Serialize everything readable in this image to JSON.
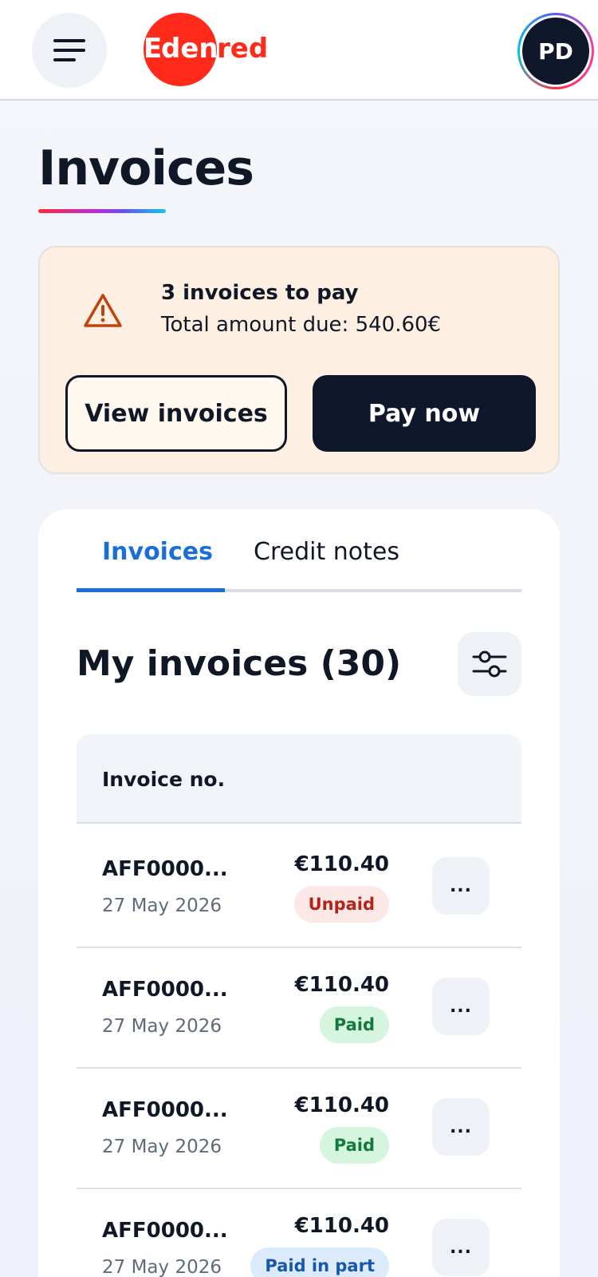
{
  "header": {
    "logo_text": "Edenred",
    "avatar_initials": "PD"
  },
  "page": {
    "title": "Invoices"
  },
  "alert": {
    "title": "3 invoices to pay",
    "amount_text": "Total amount due: 540.60€",
    "view_label": "View invoices",
    "pay_label": "Pay now"
  },
  "tabs": [
    {
      "label": "Invoices",
      "active": true
    },
    {
      "label": "Credit notes",
      "active": false
    }
  ],
  "section": {
    "title": "My invoices (30)"
  },
  "table": {
    "column_invoice": "Invoice no.",
    "rows": [
      {
        "number": "AFF0000...",
        "date": "27 May 2026",
        "amount": "€110.40",
        "status": "Unpaid"
      },
      {
        "number": "AFF0000...",
        "date": "27 May 2026",
        "amount": "€110.40",
        "status": "Paid"
      },
      {
        "number": "AFF0000...",
        "date": "27 May 2026",
        "amount": "€110.40",
        "status": "Paid"
      },
      {
        "number": "AFF0000...",
        "date": "27 May 2026",
        "amount": "€110.40",
        "status": "Paid in part"
      }
    ],
    "more_label": "..."
  },
  "colors": {
    "brand_red": "#ff2a1a",
    "accent_blue": "#1a6fd6",
    "dark": "#0f172a",
    "alert_bg": "#fdf0e2"
  }
}
